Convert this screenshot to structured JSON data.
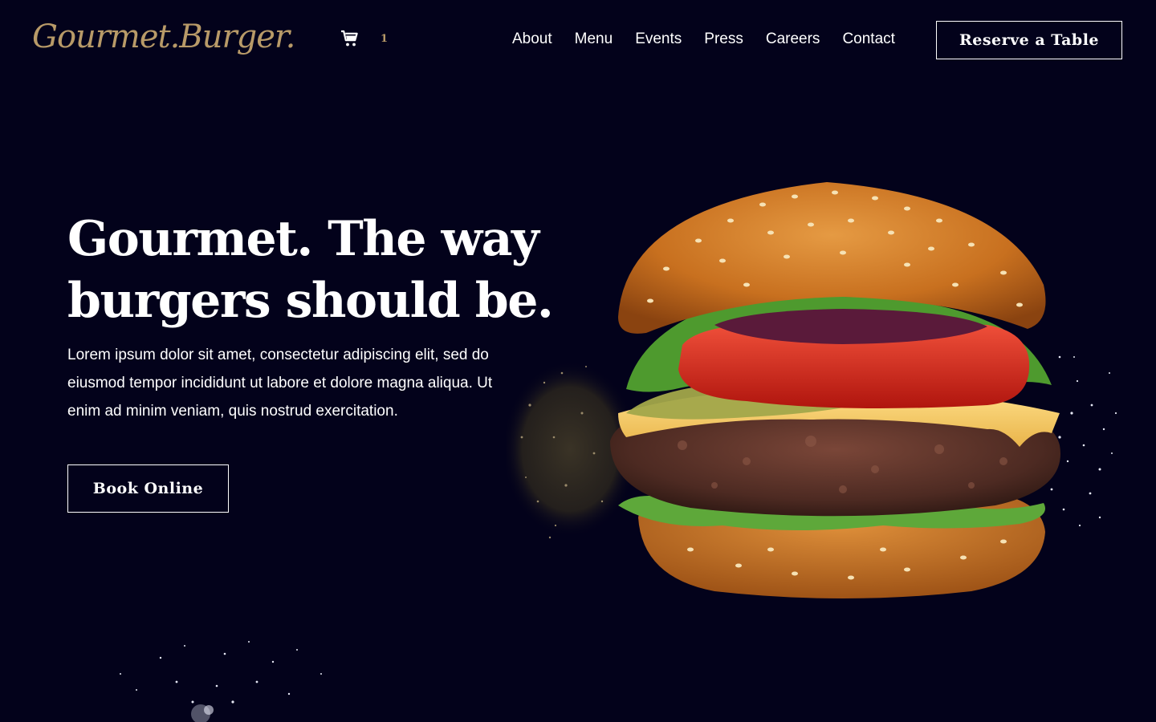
{
  "brand": {
    "logo_text": "Gourmet.Burger."
  },
  "cart": {
    "count": "1"
  },
  "nav": {
    "items": [
      "About",
      "Menu",
      "Events",
      "Press",
      "Careers",
      "Contact"
    ],
    "cta_label": "Reserve a Table"
  },
  "hero": {
    "headline_line1": "Gourmet. The way",
    "headline_line2": "burgers should be.",
    "body": "Lorem ipsum dolor sit amet, consectetur adipiscing elit, sed do eiusmod tempor incididunt ut labore et dolore magna aliqua. Ut enim ad minim veniam, quis nostrud exercitation.",
    "cta_label": "Book Online"
  },
  "colors": {
    "background": "#03021b",
    "accent_gold": "#b89a68",
    "text": "#ffffff"
  }
}
